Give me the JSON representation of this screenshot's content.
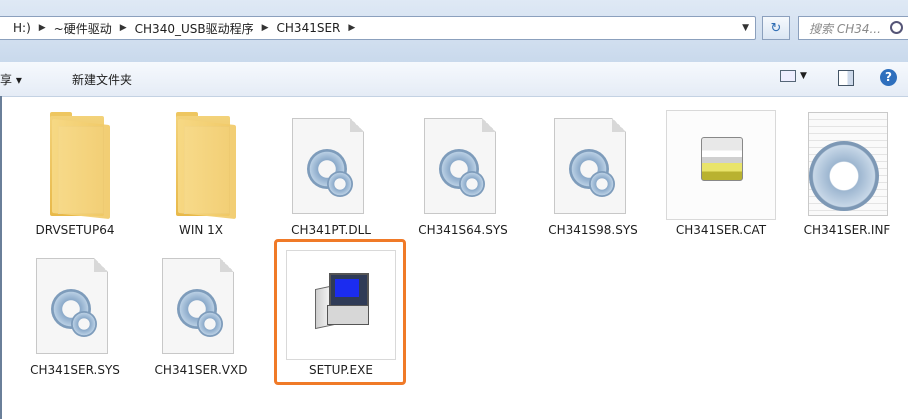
{
  "address": {
    "crumbs": [
      "H:)",
      "~硬件驱动",
      "CH340_USB驱动程序",
      "CH341SER"
    ],
    "search_placeholder": "搜索 CH34..."
  },
  "toolbar": {
    "share_label": "享 ▾",
    "new_folder_label": "新建文件夹",
    "help_label": "?"
  },
  "files": [
    {
      "name": "DRVSETUP64",
      "kind": "folder"
    },
    {
      "name": "WIN 1X",
      "kind": "folder"
    },
    {
      "name": "CH341PT.DLL",
      "kind": "system-file"
    },
    {
      "name": "CH341S64.SYS",
      "kind": "system-file"
    },
    {
      "name": "CH341S98.SYS",
      "kind": "system-file"
    },
    {
      "name": "CH341SER.CAT",
      "kind": "catalog-file"
    },
    {
      "name": "CH341SER.INF",
      "kind": "setup-info-file"
    },
    {
      "name": "CH341SER.SYS",
      "kind": "system-file"
    },
    {
      "name": "CH341SER.VXD",
      "kind": "system-file"
    },
    {
      "name": "SETUP.EXE",
      "kind": "executable",
      "highlighted": true
    }
  ],
  "colors": {
    "highlight": "#f07a28",
    "addressbar_bg": "#dfe9f5"
  }
}
